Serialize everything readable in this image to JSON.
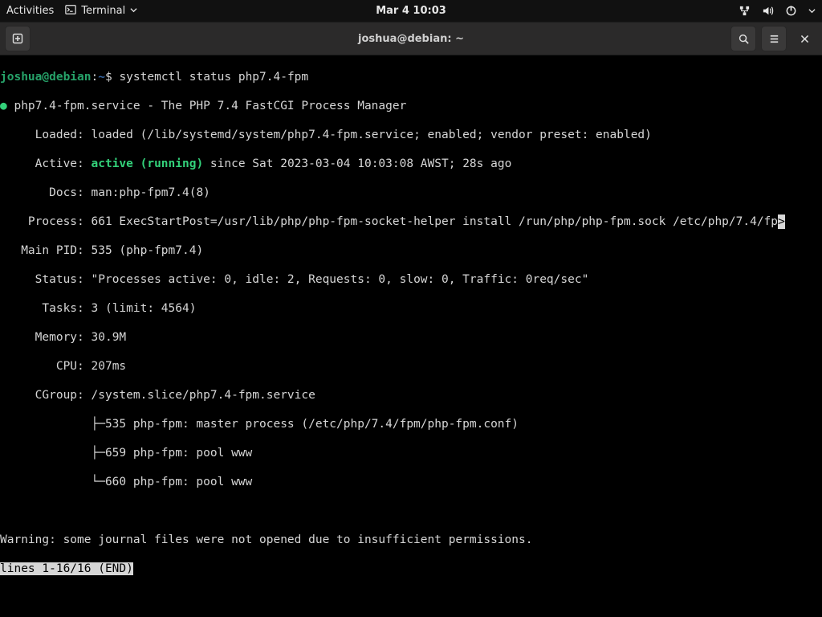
{
  "topbar": {
    "activities": "Activities",
    "app_name": "Terminal",
    "clock": "Mar 4  10:03"
  },
  "headerbar": {
    "title": "joshua@debian: ~"
  },
  "prompt": {
    "user": "joshua@debian",
    "sep1": ":",
    "path": "~",
    "sep2": "$ ",
    "command": "systemctl status php7.4-fpm"
  },
  "status": {
    "bullet": "●",
    "service_line": " php7.4-fpm.service - The PHP 7.4 FastCGI Process Manager",
    "loaded_label": "     Loaded: ",
    "loaded_value": "loaded (/lib/systemd/system/php7.4-fpm.service; enabled; vendor preset: enabled)",
    "active_label": "     Active: ",
    "active_state": "active (running)",
    "active_since": " since Sat 2023-03-04 10:03:08 AWST; 28s ago",
    "docs_label": "       Docs: ",
    "docs_value": "man:php-fpm7.4(8)",
    "process_label": "    Process: ",
    "process_value": "661 ExecStartPost=/usr/lib/php/php-fpm-socket-helper install /run/php/php-fpm.sock /etc/php/7.4/fp",
    "overflow_mark": ">",
    "mainpid_label": "   Main PID: ",
    "mainpid_value": "535 (php-fpm7.4)",
    "status_label": "     Status: ",
    "status_value": "\"Processes active: 0, idle: 2, Requests: 0, slow: 0, Traffic: 0req/sec\"",
    "tasks_label": "      Tasks: ",
    "tasks_value": "3 (limit: 4564)",
    "memory_label": "     Memory: ",
    "memory_value": "30.9M",
    "cpu_label": "        CPU: ",
    "cpu_value": "207ms",
    "cgroup_label": "     CGroup: ",
    "cgroup_value": "/system.slice/php7.4-fpm.service",
    "cg_1": "             ├─535 php-fpm: master process (/etc/php/7.4/fpm/php-fpm.conf)",
    "cg_2": "             ├─659 php-fpm: pool www",
    "cg_3": "             └─660 php-fpm: pool www",
    "warning": "Warning: some journal files were not opened due to insufficient permissions.",
    "pager": "lines 1-16/16 (END)"
  }
}
